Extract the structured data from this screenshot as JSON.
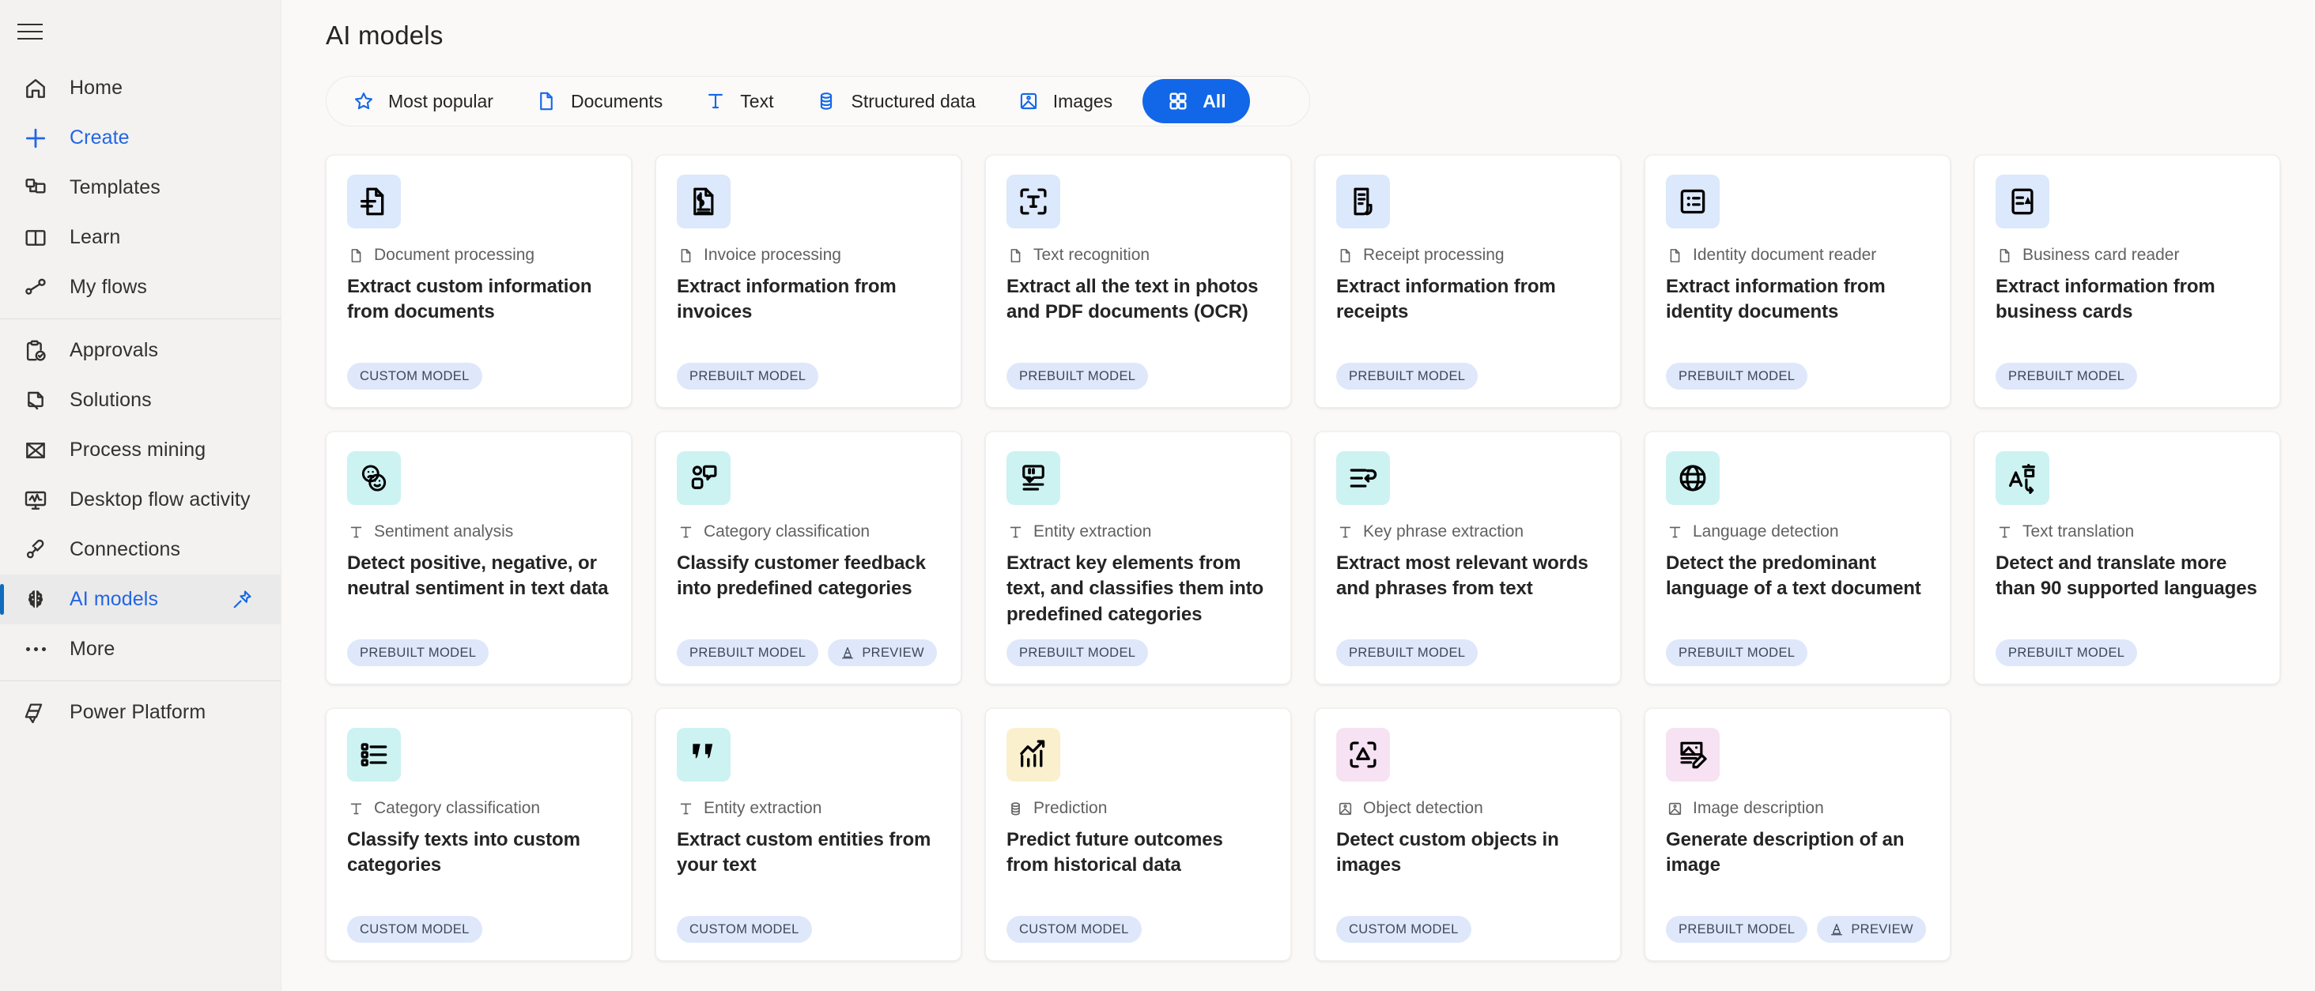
{
  "sidebar": {
    "hamburger_label": "Menu",
    "groups": [
      {
        "items": [
          {
            "label": "Home",
            "icon": "home-icon",
            "state": "normal"
          },
          {
            "label": "Create",
            "icon": "plus-icon",
            "state": "accent"
          },
          {
            "label": "Templates",
            "icon": "templates-icon",
            "state": "normal"
          },
          {
            "label": "Learn",
            "icon": "book-icon",
            "state": "normal"
          },
          {
            "label": "My flows",
            "icon": "flows-icon",
            "state": "normal"
          }
        ]
      },
      {
        "items": [
          {
            "label": "Approvals",
            "icon": "approvals-icon",
            "state": "normal"
          },
          {
            "label": "Solutions",
            "icon": "solutions-icon",
            "state": "normal"
          },
          {
            "label": "Process mining",
            "icon": "process-mining-icon",
            "state": "normal"
          },
          {
            "label": "Desktop flow activity",
            "icon": "desktop-flow-activity-icon",
            "state": "normal"
          },
          {
            "label": "Connections",
            "icon": "connections-icon",
            "state": "normal"
          },
          {
            "label": "AI models",
            "icon": "ai-models-brain-icon",
            "state": "active",
            "pinned": true
          },
          {
            "label": "More",
            "icon": "more-dots-icon",
            "state": "normal"
          }
        ]
      },
      {
        "items": [
          {
            "label": "Power Platform",
            "icon": "power-platform-icon",
            "state": "normal"
          }
        ]
      }
    ]
  },
  "header": {
    "title": "AI models"
  },
  "filters": {
    "items": [
      {
        "label": "Most popular",
        "icon": "star-icon",
        "selected": false
      },
      {
        "label": "Documents",
        "icon": "document-icon",
        "selected": false
      },
      {
        "label": "Text",
        "icon": "text-t-icon",
        "selected": false
      },
      {
        "label": "Structured data",
        "icon": "database-icon",
        "selected": false
      },
      {
        "label": "Images",
        "icon": "image-icon",
        "selected": false
      },
      {
        "label": "All",
        "icon": "grid-all-icon",
        "selected": true
      }
    ]
  },
  "badge_labels": {
    "custom": "CUSTOM MODEL",
    "prebuilt": "PREBUILT MODEL",
    "preview": "PREVIEW"
  },
  "models": [
    {
      "category": "Document processing",
      "category_icon": "document-icon",
      "title": "Extract custom information from documents",
      "icon": "document-extract-icon",
      "tint": "tint-blue",
      "badges": [
        "CUSTOM MODEL"
      ]
    },
    {
      "category": "Invoice processing",
      "category_icon": "document-icon",
      "title": "Extract information from invoices",
      "icon": "invoice-icon",
      "tint": "tint-blue",
      "badges": [
        "PREBUILT MODEL"
      ]
    },
    {
      "category": "Text recognition",
      "category_icon": "document-icon",
      "title": "Extract all the text in photos and PDF documents (OCR)",
      "icon": "ocr-scan-text-icon",
      "tint": "tint-blue",
      "badges": [
        "PREBUILT MODEL"
      ]
    },
    {
      "category": "Receipt processing",
      "category_icon": "document-icon",
      "title": "Extract information from receipts",
      "icon": "receipt-icon",
      "tint": "tint-blue",
      "badges": [
        "PREBUILT MODEL"
      ]
    },
    {
      "category": "Identity document reader",
      "category_icon": "document-icon",
      "title": "Extract information from identity documents",
      "icon": "id-card-icon",
      "tint": "tint-blue",
      "badges": [
        "PREBUILT MODEL"
      ]
    },
    {
      "category": "Business card reader",
      "category_icon": "document-icon",
      "title": "Extract information from business cards",
      "icon": "business-card-icon",
      "tint": "tint-blue",
      "badges": [
        "PREBUILT MODEL"
      ]
    },
    {
      "category": "Sentiment analysis",
      "category_icon": "text-t-icon",
      "title": "Detect positive, negative, or neutral sentiment in text data",
      "icon": "sentiment-faces-icon",
      "tint": "tint-teal",
      "badges": [
        "PREBUILT MODEL"
      ]
    },
    {
      "category": "Category classification",
      "category_icon": "text-t-icon",
      "title": "Classify customer feedback into predefined categories",
      "icon": "feedback-bubble-icon",
      "tint": "tint-teal",
      "badges": [
        "PREBUILT MODEL",
        "PREVIEW"
      ]
    },
    {
      "category": "Entity extraction",
      "category_icon": "text-t-icon",
      "title": "Extract key elements from text, and classifies them into predefined categories",
      "icon": "quote-extract-icon",
      "tint": "tint-teal",
      "badges": [
        "PREBUILT MODEL"
      ]
    },
    {
      "category": "Key phrase extraction",
      "category_icon": "text-t-icon",
      "title": "Extract most relevant words and phrases from text",
      "icon": "key-phrase-icon",
      "tint": "tint-teal",
      "badges": [
        "PREBUILT MODEL"
      ]
    },
    {
      "category": "Language detection",
      "category_icon": "text-t-icon",
      "title": "Detect the predominant language of a text document",
      "icon": "globe-icon",
      "tint": "tint-teal",
      "badges": [
        "PREBUILT MODEL"
      ]
    },
    {
      "category": "Text translation",
      "category_icon": "text-t-icon",
      "title": "Detect and translate more than 90 supported languages",
      "icon": "translate-icon",
      "tint": "tint-teal",
      "badges": [
        "PREBUILT MODEL"
      ]
    },
    {
      "category": "Category classification",
      "category_icon": "text-t-icon",
      "title": "Classify texts into custom categories",
      "icon": "category-list-icon",
      "tint": "tint-teal",
      "badges": [
        "CUSTOM MODEL"
      ]
    },
    {
      "category": "Entity extraction",
      "category_icon": "text-t-icon",
      "title": "Extract custom entities from your text",
      "icon": "quote-marks-icon",
      "tint": "tint-teal",
      "badges": [
        "CUSTOM MODEL"
      ]
    },
    {
      "category": "Prediction",
      "category_icon": "database-icon",
      "title": "Predict future outcomes from historical data",
      "icon": "trend-chart-icon",
      "tint": "tint-yellow",
      "badges": [
        "CUSTOM MODEL"
      ]
    },
    {
      "category": "Object detection",
      "category_icon": "image-icon",
      "title": "Detect custom objects in images",
      "icon": "object-scan-icon",
      "tint": "tint-pink",
      "badges": [
        "CUSTOM MODEL"
      ]
    },
    {
      "category": "Image description",
      "category_icon": "image-icon",
      "title": "Generate description of an image",
      "icon": "image-edit-icon",
      "tint": "tint-pink",
      "badges": [
        "PREBUILT MODEL",
        "PREVIEW"
      ]
    }
  ],
  "colors": {
    "accent": "#1267e8",
    "active_indicator": "#0f6cbd",
    "sidebar_bg": "#f3f2f1",
    "page_bg": "#faf9f8",
    "card_bg": "#ffffff",
    "badge_bg": "#dfe7fb",
    "tint_blue": "#dce8fb",
    "tint_teal": "#cdf2f2",
    "tint_yellow": "#fbf0cd",
    "tint_pink": "#f6e2f3"
  }
}
